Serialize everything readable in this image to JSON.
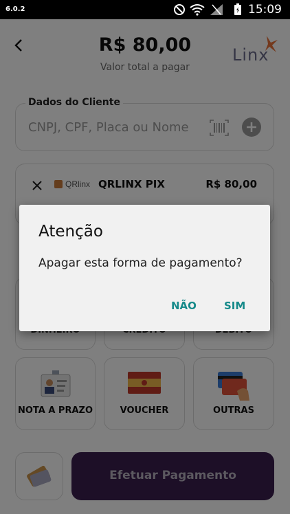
{
  "status_bar": {
    "version": "6.0.2",
    "time": "15:09"
  },
  "header": {
    "total_value": "R$ 80,00",
    "total_label": "Valor total a pagar",
    "brand": "Linx"
  },
  "client": {
    "legend": "Dados do Cliente",
    "placeholder": "CNPJ, CPF, Placa ou Nome"
  },
  "payment_item": {
    "provider_logo_text": "QRlinx",
    "name": "QRLINX PIX",
    "value": "R$ 80,00"
  },
  "methods": {
    "row1": [
      "DINHEIRO",
      "CRÉDITO",
      "DÉBITO"
    ],
    "row2": [
      "NOTA A PRAZO",
      "VOUCHER",
      "OUTRAS"
    ]
  },
  "footer": {
    "pay_label": "Efetuar Pagamento"
  },
  "dialog": {
    "title": "Atenção",
    "message": "Apagar esta forma de pagamento?",
    "no_label": "NÃO",
    "yes_label": "SIM"
  },
  "colors": {
    "primary_dark": "#3b1f4f",
    "dialog_accent": "#168a8a",
    "brand_orange": "#e8733a"
  }
}
